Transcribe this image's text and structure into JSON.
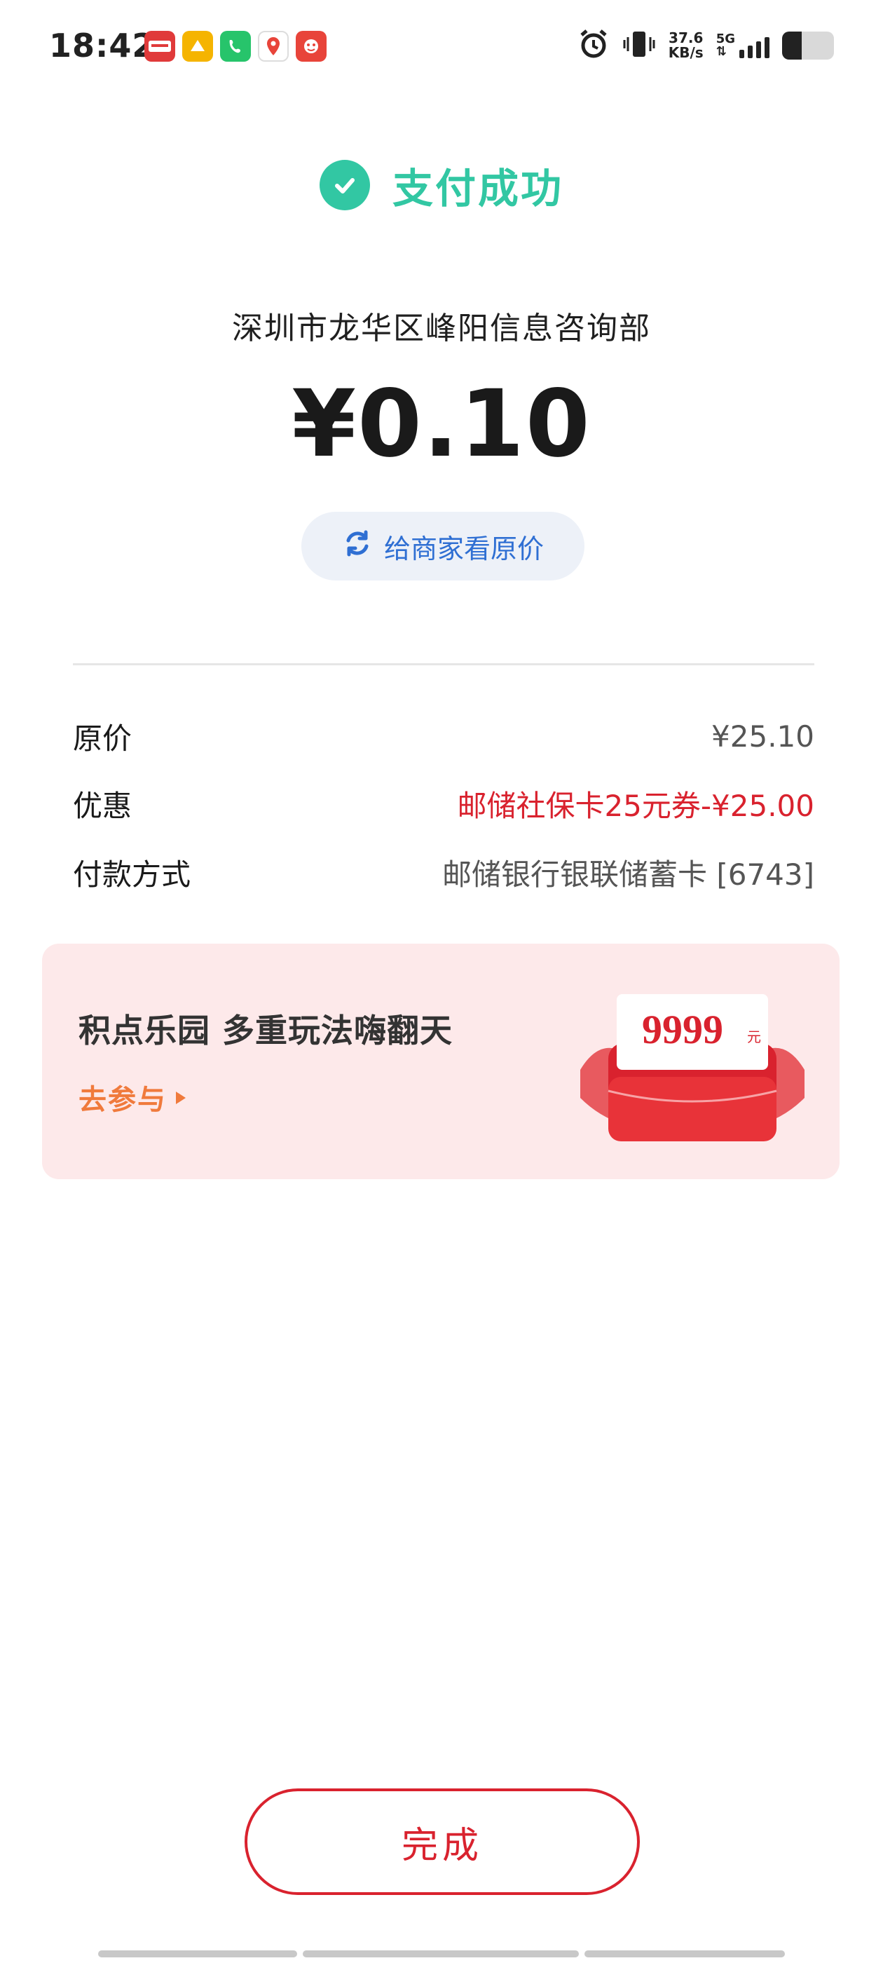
{
  "status_bar": {
    "time": "18:42",
    "apps": [
      {
        "icon": "bank-pay-app-icon",
        "label": "云闪付"
      },
      {
        "icon": "yellow-app-icon",
        "label": ""
      },
      {
        "icon": "phone-app-icon",
        "label": ""
      },
      {
        "icon": "map-app-icon",
        "label": "du"
      },
      {
        "icon": "game-app-icon",
        "label": ""
      }
    ],
    "speed_value": "37.6",
    "speed_unit": "KB/s",
    "network": "5G",
    "battery_percent": 38
  },
  "header": {
    "success_text": "支付成功",
    "accent_color": "#32c7a3"
  },
  "payment": {
    "merchant": "深圳市龙华区峰阳信息咨询部",
    "amount": "¥0.10",
    "view_original_label": "给商家看原价"
  },
  "details": [
    {
      "label": "原价",
      "value": "¥25.10",
      "highlight": false
    },
    {
      "label": "优惠",
      "value": "邮储社保卡25元券-¥25.00",
      "highlight": true
    },
    {
      "label": "付款方式",
      "value": "邮储银行银联储蓄卡 [6743]",
      "highlight": false
    }
  ],
  "promo": {
    "title": "积点乐园 多重玩法嗨翻天",
    "link_label": "去参与",
    "graphic_number": "9999",
    "graphic_unit": "元"
  },
  "footer": {
    "done_label": "完成",
    "brand_color": "#d9222e"
  }
}
